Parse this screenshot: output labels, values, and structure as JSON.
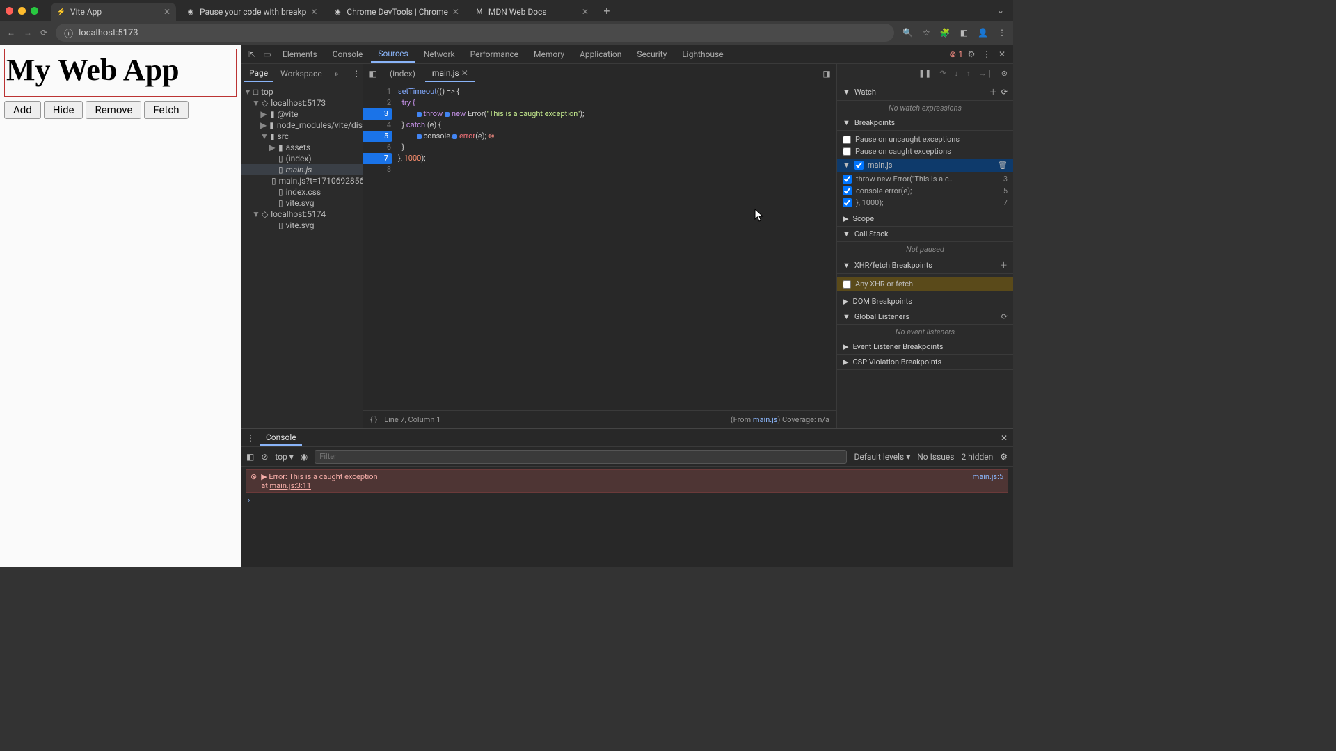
{
  "browser": {
    "tabs": [
      {
        "title": "Vite App",
        "active": true,
        "favicon": "V"
      },
      {
        "title": "Pause your code with breakp",
        "active": false,
        "favicon": "C"
      },
      {
        "title": "Chrome DevTools | Chrome",
        "active": false,
        "favicon": "C"
      },
      {
        "title": "MDN Web Docs",
        "active": false,
        "favicon": "M"
      }
    ],
    "url": "localhost:5173"
  },
  "preview": {
    "title": "My Web App",
    "buttons": [
      "Add",
      "Hide",
      "Remove",
      "Fetch"
    ]
  },
  "devtools": {
    "panels": [
      "Elements",
      "Console",
      "Sources",
      "Network",
      "Performance",
      "Memory",
      "Application",
      "Security",
      "Lighthouse"
    ],
    "active_panel": "Sources",
    "error_count": "1"
  },
  "nav": {
    "tabs": [
      "Page",
      "Workspace"
    ],
    "active": "Page",
    "tree": [
      {
        "indent": 0,
        "arrow": "▼",
        "icon": "□",
        "label": "top"
      },
      {
        "indent": 1,
        "arrow": "▼",
        "icon": "◇",
        "label": "localhost:5173"
      },
      {
        "indent": 2,
        "arrow": "▶",
        "icon": "▮",
        "label": "@vite"
      },
      {
        "indent": 2,
        "arrow": "▶",
        "icon": "▮",
        "label": "node_modules/vite/dis"
      },
      {
        "indent": 2,
        "arrow": "▼",
        "icon": "▮",
        "label": "src"
      },
      {
        "indent": 3,
        "arrow": "▶",
        "icon": "▮",
        "label": "assets"
      },
      {
        "indent": 3,
        "arrow": "",
        "icon": "▯",
        "label": "(index)"
      },
      {
        "indent": 3,
        "arrow": "",
        "icon": "▯",
        "label": "main.js",
        "sel": true,
        "italic": true
      },
      {
        "indent": 3,
        "arrow": "",
        "icon": "▯",
        "label": "main.js?t=1710692856"
      },
      {
        "indent": 3,
        "arrow": "",
        "icon": "▯",
        "label": "index.css"
      },
      {
        "indent": 3,
        "arrow": "",
        "icon": "▯",
        "label": "vite.svg"
      },
      {
        "indent": 1,
        "arrow": "▼",
        "icon": "◇",
        "label": "localhost:5174"
      },
      {
        "indent": 3,
        "arrow": "",
        "icon": "▯",
        "label": "vite.svg"
      }
    ]
  },
  "editor": {
    "tabs": [
      "(index)",
      "main.js"
    ],
    "active_tab": "main.js",
    "gutter": [
      {
        "n": "1"
      },
      {
        "n": "2"
      },
      {
        "n": "3",
        "bp": true
      },
      {
        "n": "4"
      },
      {
        "n": "5",
        "bp": true
      },
      {
        "n": "6"
      },
      {
        "n": "7",
        "bp": true
      },
      {
        "n": "8"
      }
    ],
    "status_left": "Line 7, Column 1",
    "status_from": "(From ",
    "status_file": "main.js",
    "status_cov": ") Coverage: n/a"
  },
  "code": {
    "l1a": "setTimeout",
    "l1b": "(() => {",
    "l2": "  try {",
    "l3a": "throw ",
    "l3b": "new ",
    "l3c": "Error(",
    "l3d": "\"This is a caught exception\"",
    "l3e": ");",
    "l4a": "  } ",
    "l4b": "catch ",
    "l4c": "(e) {",
    "l5a": "console.",
    "l5b": "error",
    "l5c": "(e); ",
    "l6": "  }",
    "l7a": "}, ",
    "l7b": "1000",
    "l7c": ");"
  },
  "sidebar": {
    "watch": {
      "title": "Watch",
      "empty": "No watch expressions"
    },
    "breakpoints": {
      "title": "Breakpoints",
      "uncaught": "Pause on uncaught exceptions",
      "caught": "Pause on caught exceptions",
      "file": "main.js",
      "items": [
        {
          "text": "throw new Error(\"This is a c…",
          "ln": "3"
        },
        {
          "text": "console.error(e);",
          "ln": "5"
        },
        {
          "text": "}, 1000);",
          "ln": "7"
        }
      ]
    },
    "scope": "Scope",
    "callstack": {
      "title": "Call Stack",
      "msg": "Not paused"
    },
    "xhr": {
      "title": "XHR/fetch Breakpoints",
      "any": "Any XHR or fetch"
    },
    "dom": "DOM Breakpoints",
    "global": {
      "title": "Global Listeners",
      "msg": "No event listeners"
    },
    "evlist": "Event Listener Breakpoints",
    "csp": "CSP Violation Breakpoints"
  },
  "console": {
    "tab": "Console",
    "context": "top",
    "filter_placeholder": "Filter",
    "levels": "Default levels",
    "issues": "No Issues",
    "hidden": "2 hidden",
    "err_text": "Error: This is a caught exception",
    "err_at": "    at ",
    "err_loc": "main.js:3:11",
    "err_src": "main.js:5"
  }
}
